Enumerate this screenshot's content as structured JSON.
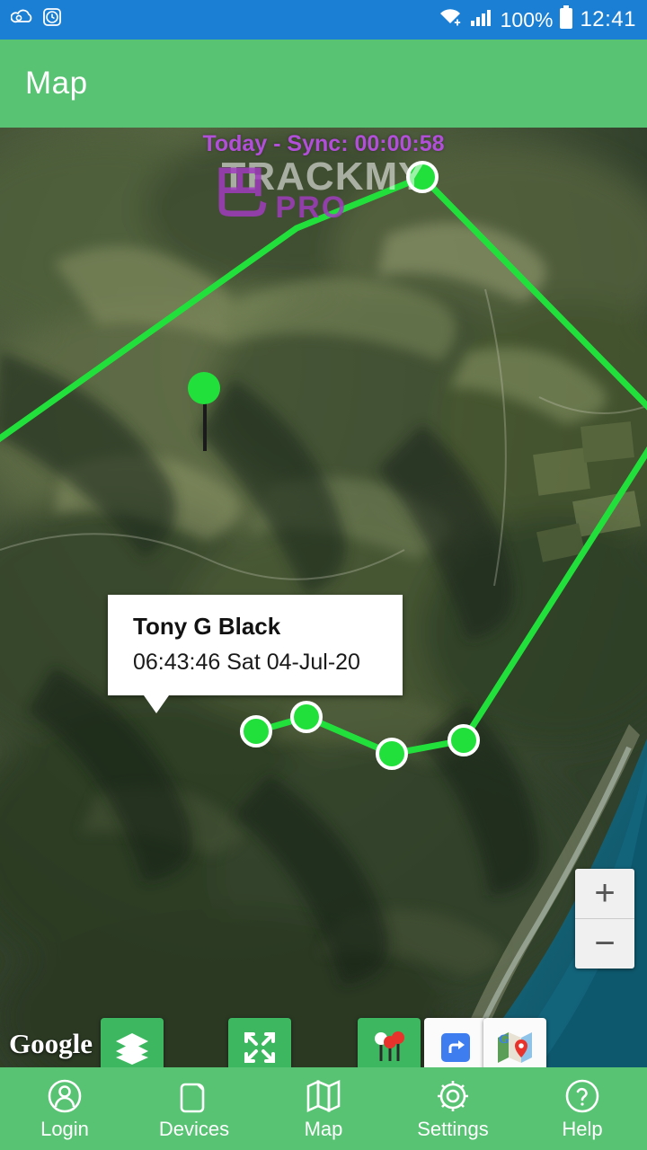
{
  "status_bar": {
    "left_icons": [
      "cloud-sync-icon",
      "alarm-history-icon"
    ],
    "right_icons": [
      "wifi-icon",
      "signal-icon",
      "battery-icon"
    ],
    "battery_percent": "100%",
    "clock": "12:41"
  },
  "app_bar": {
    "title": "Map"
  },
  "map": {
    "sync_label": "Today - Sync: 00:00:58",
    "watermark_main": "TRACKMY",
    "watermark_sub": "PRO",
    "google_logo": "Google",
    "zoom_in": "+",
    "zoom_out": "−",
    "callout": {
      "name": "Tony G Black",
      "timestamp": "06:43:46 Sat 04-Jul-20"
    },
    "buttons": [
      {
        "name": "layers-button",
        "icon": "layers-icon"
      },
      {
        "name": "fullscreen-button",
        "icon": "expand-arrows-icon"
      },
      {
        "name": "markers-button",
        "icon": "map-pins-icon"
      },
      {
        "name": "directions-button",
        "icon": "directions-arrow-icon"
      },
      {
        "name": "google-maps-button",
        "icon": "google-maps-icon"
      }
    ],
    "track_color": "#22e03c",
    "accent_color": "#57c373"
  },
  "bottom_nav": {
    "items": [
      {
        "label": "Login",
        "icon": "person-circle-icon",
        "active": false
      },
      {
        "label": "Devices",
        "icon": "device-icon",
        "active": false
      },
      {
        "label": "Map",
        "icon": "map-icon",
        "active": true
      },
      {
        "label": "Settings",
        "icon": "gear-icon",
        "active": false
      },
      {
        "label": "Help",
        "icon": "question-circle-icon",
        "active": false
      }
    ]
  }
}
